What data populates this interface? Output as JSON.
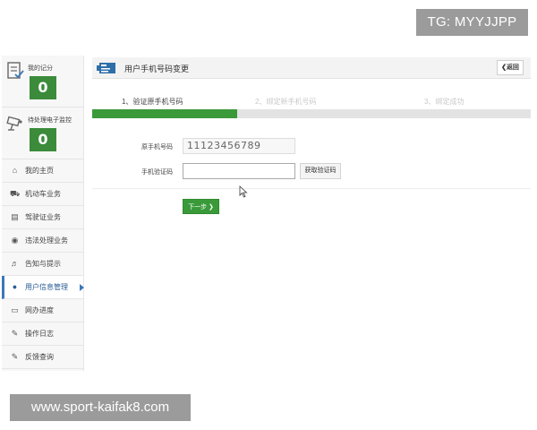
{
  "watermarks": {
    "tg": "TG: MYYJJPP",
    "url": "www.sport-kaifak8.com"
  },
  "sidebar": {
    "stats": [
      {
        "label": "我的记分",
        "count": "0",
        "icon": "scorecard-icon"
      },
      {
        "label": "待处理电子监控",
        "count": "0",
        "icon": "camera-icon"
      }
    ],
    "items": [
      {
        "label": "我的主页",
        "icon": "home-icon",
        "active": false
      },
      {
        "label": "机动车业务",
        "icon": "truck-icon",
        "active": false
      },
      {
        "label": "驾驶证业务",
        "icon": "id-card-icon",
        "active": false
      },
      {
        "label": "违法处理业务",
        "icon": "camera-icon",
        "active": false
      },
      {
        "label": "告知与提示",
        "icon": "bell-icon",
        "active": false
      },
      {
        "label": "用户信息管理",
        "icon": "user-icon",
        "active": true
      },
      {
        "label": "网办进度",
        "icon": "progress-icon",
        "active": false
      },
      {
        "label": "操作日志",
        "icon": "log-icon",
        "active": false
      },
      {
        "label": "反馈查询",
        "icon": "feedback-icon",
        "active": false
      }
    ]
  },
  "header": {
    "title": "用户手机号码变更",
    "back_label": "❮返回"
  },
  "steps": {
    "items": [
      "1、验证原手机号码",
      "2、绑定新手机号码",
      "3、绑定成功"
    ],
    "progress": 0.33
  },
  "form": {
    "phone_label": "原手机号码",
    "phone_value": "11123456789",
    "code_label": "手机验证码",
    "code_value": "",
    "get_code_label": "获取验证码",
    "next_label": "下一步 ❯"
  },
  "colors": {
    "accent_green": "#3a9a3a",
    "active_blue": "#3b78b8"
  }
}
